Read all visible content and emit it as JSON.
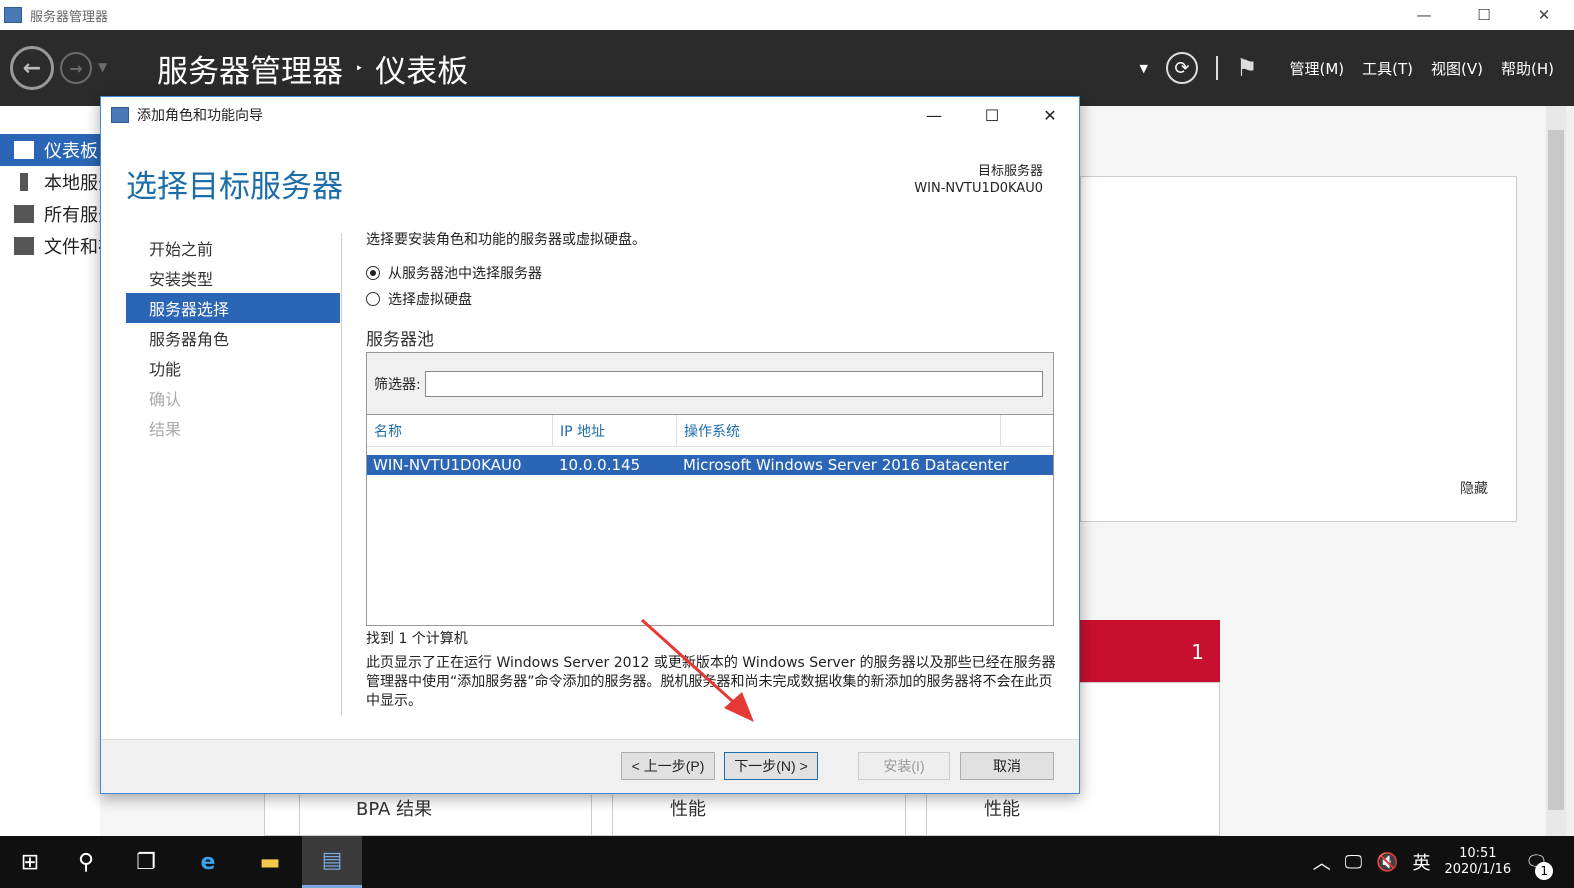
{
  "window": {
    "title": "服务器管理器",
    "minimize": "—",
    "maximize": "☐",
    "close": "✕"
  },
  "header": {
    "breadcrumb_root": "服务器管理器",
    "breadcrumb_sep": "‣",
    "breadcrumb_current": "仪表板",
    "menu": [
      "管理(M)",
      "工具(T)",
      "视图(V)",
      "帮助(H)"
    ]
  },
  "sidebar": {
    "items": [
      {
        "label": "仪表板",
        "active": true
      },
      {
        "label": "本地服务器",
        "active": false
      },
      {
        "label": "所有服务器",
        "active": false
      },
      {
        "label": "文件和存储服务",
        "active": false
      }
    ]
  },
  "background": {
    "hide": "隐藏",
    "tile_count": "1",
    "bpa": "BPA 结果",
    "perf1": "性能",
    "perf2": "性能"
  },
  "wizard": {
    "title": "添加角色和功能向导",
    "heading": "选择目标服务器",
    "dest_label": "目标服务器",
    "dest_server": "WIN-NVTU1D0KAU0",
    "steps": [
      {
        "label": "开始之前",
        "state": "normal"
      },
      {
        "label": "安装类型",
        "state": "normal"
      },
      {
        "label": "服务器选择",
        "state": "active"
      },
      {
        "label": "服务器角色",
        "state": "normal"
      },
      {
        "label": "功能",
        "state": "normal"
      },
      {
        "label": "确认",
        "state": "disabled"
      },
      {
        "label": "结果",
        "state": "disabled"
      }
    ],
    "intro": "选择要安装角色和功能的服务器或虚拟硬盘。",
    "radio_pool": "从服务器池中选择服务器",
    "radio_vhd": "选择虚拟硬盘",
    "pool_title": "服务器池",
    "filter_label": "筛选器:",
    "filter_value": "",
    "columns": [
      "名称",
      "IP 地址",
      "操作系统"
    ],
    "row": {
      "name": "WIN-NVTU1D0KAU0",
      "ip": "10.0.0.145",
      "os": "Microsoft Windows Server 2016 Datacenter"
    },
    "found": "找到 1 个计算机",
    "note": "此页显示了正在运行 Windows Server 2012 或更新版本的 Windows Server 的服务器以及那些已经在服务器管理器中使用“添加服务器”命令添加的服务器。脱机服务器和尚未完成数据收集的新添加的服务器将不会在此页中显示。",
    "btn_prev": "< 上一步(P)",
    "btn_next": "下一步(N) >",
    "btn_install": "安装(I)",
    "btn_cancel": "取消"
  },
  "taskbar": {
    "ime": "英",
    "time": "10:51",
    "date": "2020/1/16",
    "notif_count": "1"
  }
}
